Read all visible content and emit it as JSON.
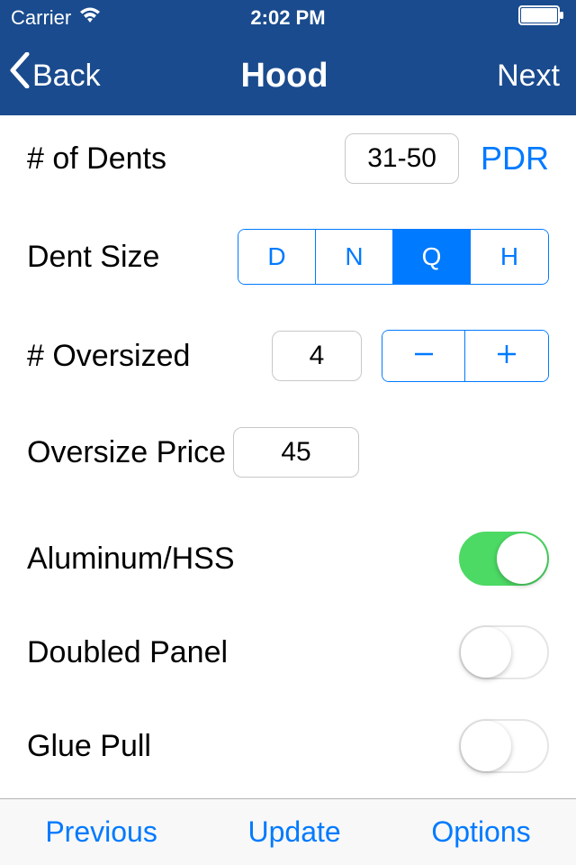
{
  "status": {
    "carrier": "Carrier",
    "time": "2:02 PM"
  },
  "nav": {
    "back": "Back",
    "title": "Hood",
    "next": "Next"
  },
  "rows": {
    "dents_label": "# of Dents",
    "dents_value": "31-50",
    "pdr": "PDR",
    "size_label": "Dent Size",
    "size_options": {
      "d": "D",
      "n": "N",
      "q": "Q",
      "h": "H"
    },
    "oversized_label": "# Oversized",
    "oversized_value": "4",
    "price_label": "Oversize Price",
    "price_value": "45",
    "aluminum": "Aluminum/HSS",
    "doubled": "Doubled Panel",
    "glue": "Glue Pull"
  },
  "bottom": {
    "previous": "Previous",
    "update": "Update",
    "options": "Options"
  }
}
